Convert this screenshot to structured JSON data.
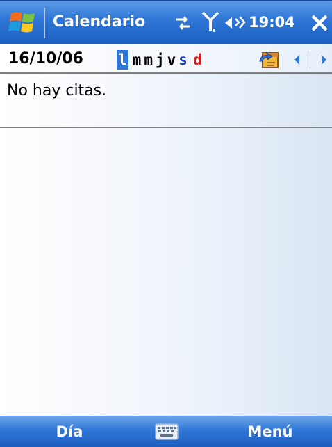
{
  "title_bar": {
    "start_icon": "windows-flag-icon",
    "title": "Calendario",
    "status_icons": [
      "connectivity-icon",
      "signal-icon",
      "speaker-icon"
    ],
    "clock": "19:04",
    "close_icon": "close-icon"
  },
  "header": {
    "date": "16/10/06",
    "weekdays": [
      "l",
      "m",
      "m",
      "j",
      "v",
      "s",
      "d"
    ],
    "selected_weekday_index": 0,
    "colors": {
      "selected_bg": "#2f76d6",
      "saturday": "#1b3fb8",
      "sunday": "#d81a1a"
    },
    "today_icon": "go-to-today-icon",
    "prev_icon": "left-arrow-icon",
    "next_icon": "right-arrow-icon"
  },
  "content": {
    "message": "No hay citas."
  },
  "softkeys": {
    "left": "Día",
    "center_icon": "keyboard-icon",
    "right": "Menú"
  }
}
